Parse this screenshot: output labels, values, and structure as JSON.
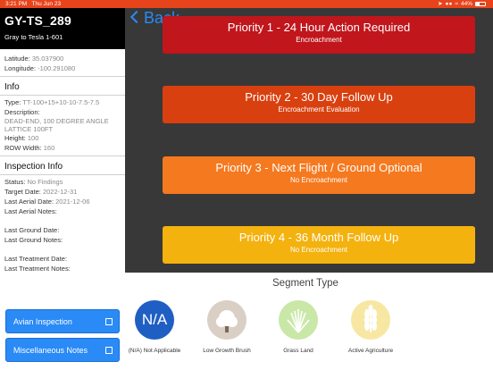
{
  "statusbar": {
    "time": "3:21 PM",
    "date": "Thu Jun 23",
    "battery": "44%"
  },
  "sidebar": {
    "title": "GY-TS_289",
    "subtitle": "Gray to Tesla 1-601",
    "latitude_label": "Latitude:",
    "latitude": "35.037900",
    "longitude_label": "Longitude:",
    "longitude": "-100.291080",
    "info_heading": "Info",
    "type_label": "Type:",
    "type": "TT-100+15+10-10-7.5-7.5",
    "description_label": "Description:",
    "description": "DEAD-END, 100 DEGREE ANGLE LATTICE 100FT",
    "height_label": "Height:",
    "height": "100",
    "row_label": "ROW Width:",
    "row": "160",
    "inspection_heading": "Inspection Info",
    "status_label": "Status:",
    "status": "No Findings",
    "target_label": "Target Date:",
    "target": "2022-12-31",
    "last_aerial_label": "Last Aerial Date:",
    "last_aerial": "2021-12-06",
    "last_aerial_notes_label": "Last Aerial Notes:",
    "last_ground_label": "Last Ground Date:",
    "last_ground_notes_label": "Last Ground Notes:",
    "last_treatment_label": "Last Treatment Date:",
    "last_treatment_notes_label": "Last Treatment Notes:",
    "btn_avian": "Avian Inspection",
    "btn_misc": "Miscellaneous Notes"
  },
  "nav": {
    "back": "Back"
  },
  "priorities": [
    {
      "title": "Priority 1 - 24 Hour Action Required",
      "sub": "Encroachment",
      "color": "#c0161c"
    },
    {
      "title": "Priority 2 - 30 Day Follow Up",
      "sub": "Encroachment Evaluation",
      "color": "#d9400f"
    },
    {
      "title": "Priority 3 - Next Flight / Ground Optional",
      "sub": "No Encroachment",
      "color": "#f5791f"
    },
    {
      "title": "Priority 4 - 36 Month Follow Up",
      "sub": "No Encroachment",
      "color": "#f4b20f"
    }
  ],
  "segment": {
    "title": "Segment Type",
    "items": [
      {
        "icon": "na-icon",
        "icon_text": "N/A",
        "label": "(N/A) Not Applicable",
        "color": "#1f5fc4"
      },
      {
        "icon": "brush-icon",
        "label": "Low Growth Brush",
        "color": "#d9cfc4"
      },
      {
        "icon": "grass-icon",
        "label": "Grass Land",
        "color": "#c9e8a8"
      },
      {
        "icon": "wheat-icon",
        "label": "Active Agriculture",
        "color": "#f7e7a2"
      }
    ]
  }
}
